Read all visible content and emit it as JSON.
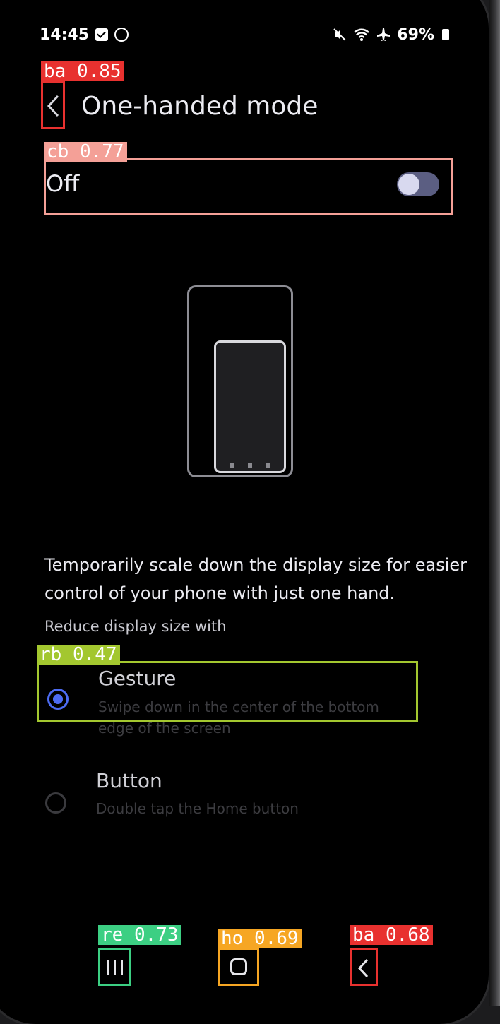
{
  "status_bar": {
    "time": "14:45",
    "battery": "69%",
    "icons_left": [
      "check-square-icon",
      "circle-icon"
    ],
    "icons_right": [
      "mute-icon",
      "wifi-icon",
      "airplane-icon",
      "battery-icon"
    ]
  },
  "header": {
    "title": "One-handed mode",
    "back_tag": "ba 0.85"
  },
  "toggle": {
    "label": "Off",
    "state": "off",
    "tag": "cb 0.77"
  },
  "description": "Temporarily scale down the display size for easier control of your phone with just one hand.",
  "section_label": "Reduce display size with",
  "options": [
    {
      "title": "Gesture",
      "subtitle": "Swipe down in the center of the bottom edge of the screen",
      "selected": true,
      "tag": "rb 0.47"
    },
    {
      "title": "Button",
      "subtitle": "Double tap the Home button",
      "selected": false
    }
  ],
  "navbar": {
    "recents_tag": "re 0.73",
    "home_tag": "ho 0.69",
    "back_tag": "ba 0.68"
  },
  "colors": {
    "back_box": "#e8312f",
    "toggle_box": "#f4a097",
    "radio_box": "#a3c72f",
    "recents_box": "#3ccf83",
    "home_box": "#f6a623",
    "accent": "#4d6cf3"
  }
}
